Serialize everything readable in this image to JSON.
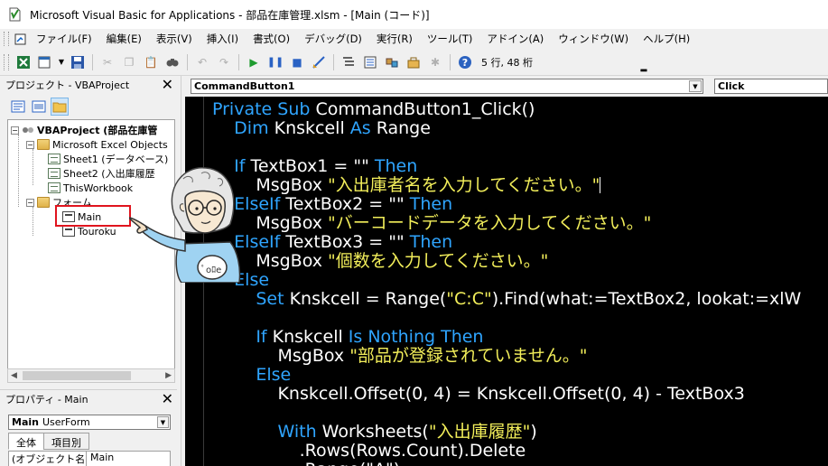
{
  "window": {
    "title": "Microsoft Visual Basic for Applications - 部品在庫管理.xlsm - [Main (コード)]"
  },
  "menu": {
    "items": [
      {
        "label": "ファイル(F)"
      },
      {
        "label": "編集(E)"
      },
      {
        "label": "表示(V)"
      },
      {
        "label": "挿入(I)"
      },
      {
        "label": "書式(O)"
      },
      {
        "label": "デバッグ(D)"
      },
      {
        "label": "実行(R)"
      },
      {
        "label": "ツール(T)"
      },
      {
        "label": "アドイン(A)"
      },
      {
        "label": "ウィンドウ(W)"
      },
      {
        "label": "ヘルプ(H)"
      }
    ]
  },
  "toolbar": {
    "position_text": "5 行, 48 桁"
  },
  "project_pane": {
    "title": "プロジェクト - VBAProject",
    "tree": {
      "project": "VBAProject (部品在庫管",
      "excel_objects": "Microsoft Excel Objects",
      "sheet1": "Sheet1 (データベース)",
      "sheet2": "Sheet2 (入出庫履歴",
      "workbook": "ThisWorkbook",
      "forms": "フォーム",
      "form_main": "Main",
      "form_touroku": "Touroku"
    }
  },
  "properties_pane": {
    "title": "プロパティ - Main",
    "object_name": "Main",
    "object_type": "UserForm",
    "tabs": [
      {
        "label": "全体"
      },
      {
        "label": "項目別"
      }
    ],
    "row_key": "(オブジェクト名)",
    "row_value": "Main"
  },
  "code_window": {
    "object_combo": "CommandButton1",
    "proc_combo": "Click",
    "lines": [
      [
        {
          "t": "Private Sub ",
          "c": "kw"
        },
        {
          "t": "CommandButton1_Click()",
          "c": "txt"
        }
      ],
      [
        {
          "t": "    Dim ",
          "c": "kw"
        },
        {
          "t": "Knskcell ",
          "c": "txt"
        },
        {
          "t": "As ",
          "c": "kw"
        },
        {
          "t": "Range",
          "c": "txt"
        }
      ],
      [],
      [
        {
          "t": "    If ",
          "c": "kw"
        },
        {
          "t": "TextBox1 = \"\" ",
          "c": "txt"
        },
        {
          "t": "Then",
          "c": "kw"
        }
      ],
      [
        {
          "t": "        MsgBox ",
          "c": "txt"
        },
        {
          "t": "\"入出庫者名を入力してください。\"",
          "c": "str"
        },
        {
          "t": "CARET",
          "c": "caret"
        }
      ],
      [
        {
          "t": "    ElseIf ",
          "c": "kw"
        },
        {
          "t": "TextBox2 = \"\" ",
          "c": "txt"
        },
        {
          "t": "Then",
          "c": "kw"
        }
      ],
      [
        {
          "t": "        MsgBox ",
          "c": "txt"
        },
        {
          "t": "\"バーコードデータを入力してください。\"",
          "c": "str"
        }
      ],
      [
        {
          "t": "    ElseIf ",
          "c": "kw"
        },
        {
          "t": "TextBox3 = \"\" ",
          "c": "txt"
        },
        {
          "t": "Then",
          "c": "kw"
        }
      ],
      [
        {
          "t": "        MsgBox ",
          "c": "txt"
        },
        {
          "t": "\"個数を入力してください。\"",
          "c": "str"
        }
      ],
      [
        {
          "t": "    Else",
          "c": "kw"
        }
      ],
      [
        {
          "t": "        Set ",
          "c": "kw"
        },
        {
          "t": "Knskcell = Range(",
          "c": "txt"
        },
        {
          "t": "\"C:C\"",
          "c": "str"
        },
        {
          "t": ").Find(what:=TextBox2, lookat:=xlW",
          "c": "txt"
        }
      ],
      [],
      [
        {
          "t": "        If ",
          "c": "kw"
        },
        {
          "t": "Knskcell ",
          "c": "txt"
        },
        {
          "t": "Is Nothing Then",
          "c": "kw"
        }
      ],
      [
        {
          "t": "            MsgBox ",
          "c": "txt"
        },
        {
          "t": "\"部品が登録されていません。\"",
          "c": "str"
        }
      ],
      [
        {
          "t": "        Else",
          "c": "kw"
        }
      ],
      [
        {
          "t": "            Knskcell.Offset(0, 4) = Knskcell.Offset(0, 4) - TextBox3",
          "c": "txt"
        }
      ],
      [],
      [
        {
          "t": "            With ",
          "c": "kw"
        },
        {
          "t": "Worksheets(",
          "c": "txt"
        },
        {
          "t": "\"入出庫履歴\"",
          "c": "str"
        },
        {
          "t": ")",
          "c": "txt"
        }
      ],
      [
        {
          "t": "                .Rows(Rows.Count).Delete",
          "c": "txt"
        }
      ],
      [
        {
          "t": "                .Range(\"A\").",
          "c": "txt"
        }
      ]
    ]
  },
  "mascot": {
    "hand_text": "ﾟoﾛe"
  }
}
